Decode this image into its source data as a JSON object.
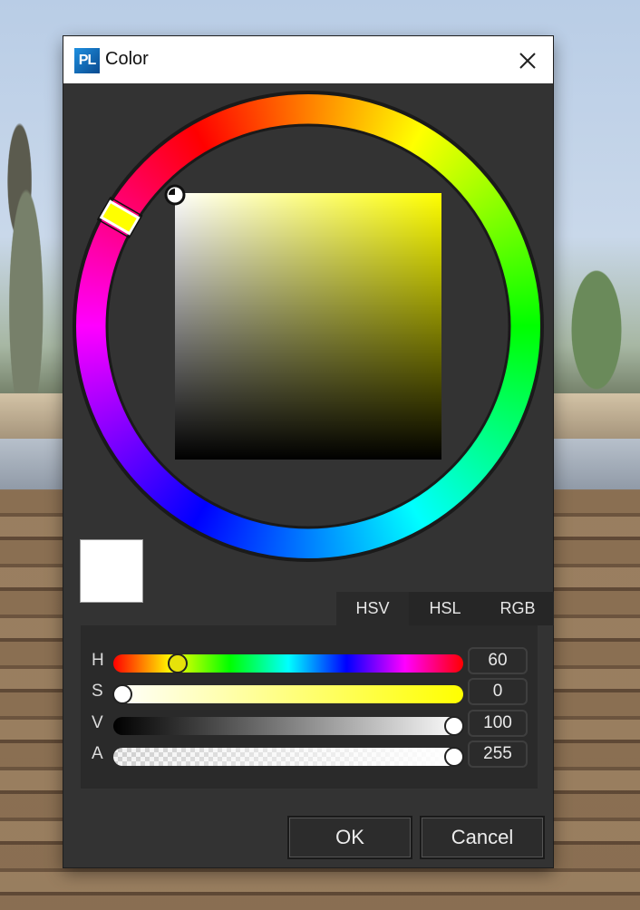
{
  "window": {
    "title": "Color",
    "logo_text": "PL"
  },
  "colors": {
    "dialog_bg": "#333333",
    "selected_color": "#ffffff",
    "hue_indicator": "#ffff00"
  },
  "tabs": [
    {
      "label": "HSV",
      "active": true
    },
    {
      "label": "HSL",
      "active": false
    },
    {
      "label": "RGB",
      "active": false
    }
  ],
  "channels": [
    {
      "key": "h",
      "label": "H",
      "value": "60",
      "fraction": 0.1667
    },
    {
      "key": "s",
      "label": "S",
      "value": "0",
      "fraction": 0.0
    },
    {
      "key": "v",
      "label": "V",
      "value": "100",
      "fraction": 1.0
    },
    {
      "key": "a",
      "label": "A",
      "value": "255",
      "fraction": 1.0
    }
  ],
  "buttons": {
    "ok": "OK",
    "cancel": "Cancel"
  },
  "icons": {
    "close": "close-icon",
    "logo": "app-logo-icon"
  }
}
